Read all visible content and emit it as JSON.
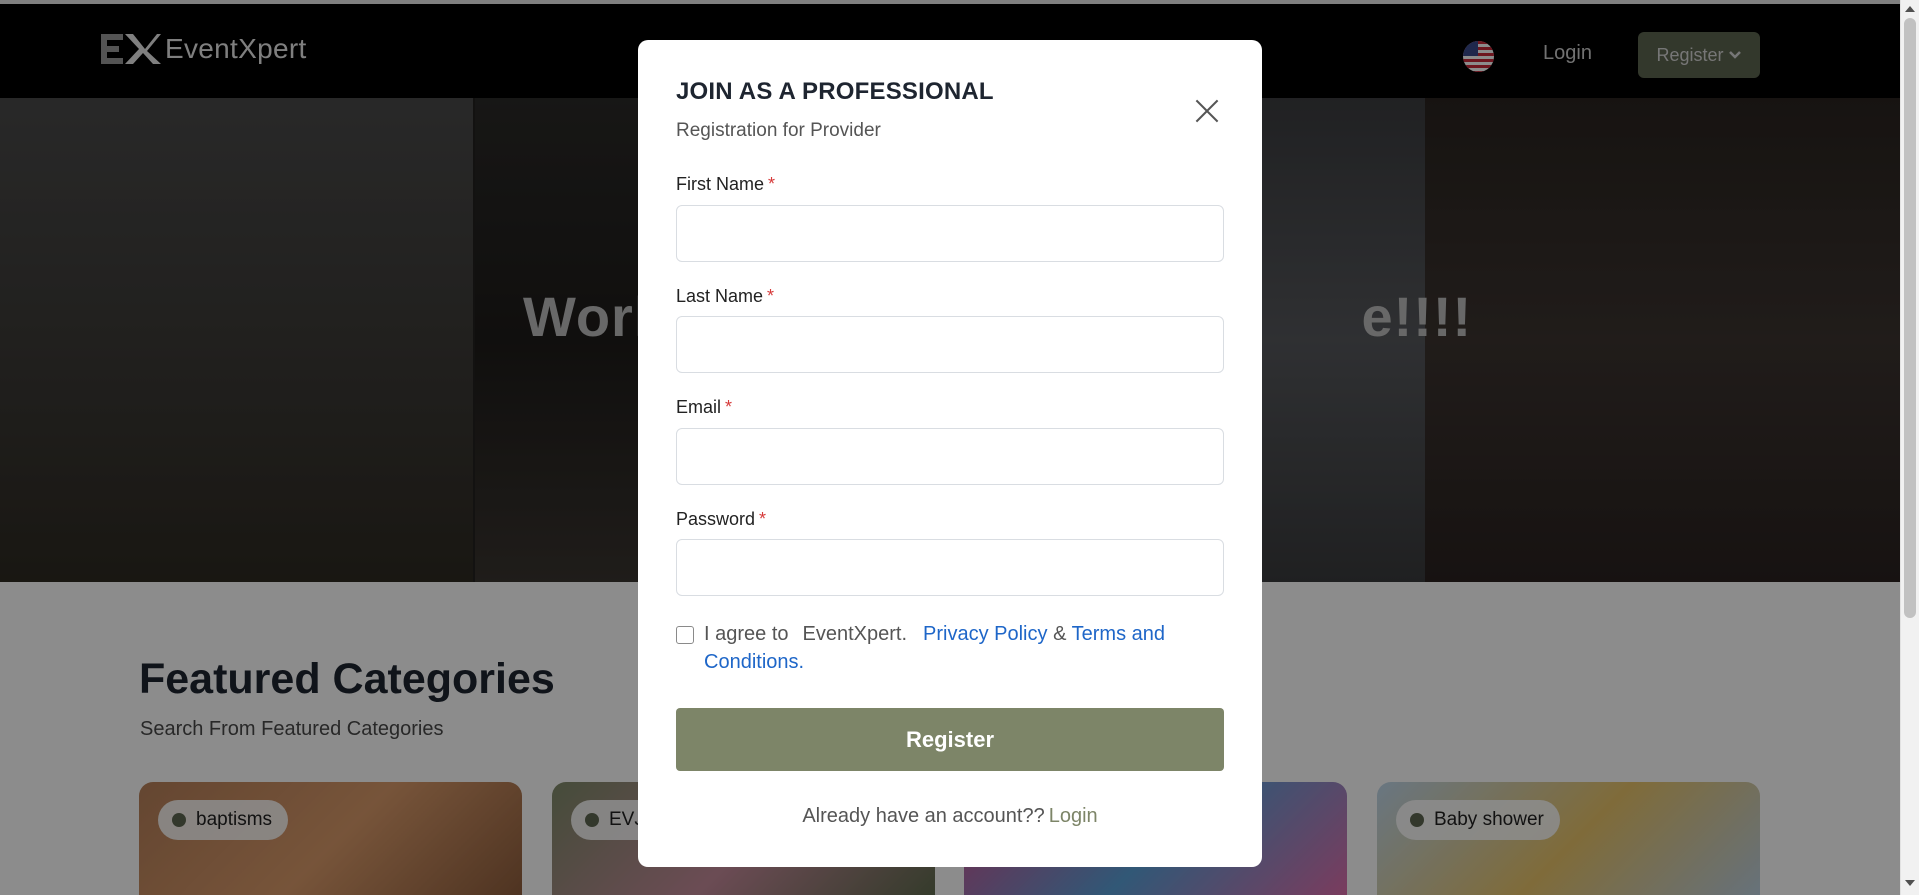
{
  "header": {
    "logo_mark": "EX",
    "logo_text": "EventXpert",
    "login_label": "Login",
    "register_label": "Register"
  },
  "hero": {
    "title": "Work                                          e!!!!"
  },
  "featured": {
    "title": "Featured Categories",
    "subtitle": "Search From Featured Categories",
    "cards": [
      {
        "label": "baptisms"
      },
      {
        "label": "EVJ"
      },
      {
        "label": ""
      },
      {
        "label": "Baby shower"
      }
    ]
  },
  "modal": {
    "title": "JOIN AS A PROFESSIONAL",
    "subtitle": "Registration for Provider",
    "fields": [
      {
        "label": "First Name",
        "required": "*",
        "value": ""
      },
      {
        "label": "Last Name",
        "required": "*",
        "value": ""
      },
      {
        "label": "Email",
        "required": "*",
        "value": ""
      },
      {
        "label": "Password",
        "required": "*",
        "value": ""
      }
    ],
    "agree": {
      "prefix": "I agree to",
      "brand": "EventXpert.",
      "privacy": "Privacy Policy",
      "amp": "&",
      "terms": "Terms and Conditions."
    },
    "register_button": "Register",
    "already_text": "Already have an account??",
    "login_link": "Login"
  },
  "colors": {
    "accent": "#7d8568",
    "nav_register_bg": "#5e6650",
    "link": "#1e66c8",
    "required": "#d63a3a",
    "navbar_bg": "#000000"
  },
  "icons": {
    "flag": "us-flag-icon",
    "dropdown": "chevron-down-icon",
    "close": "close-icon"
  }
}
